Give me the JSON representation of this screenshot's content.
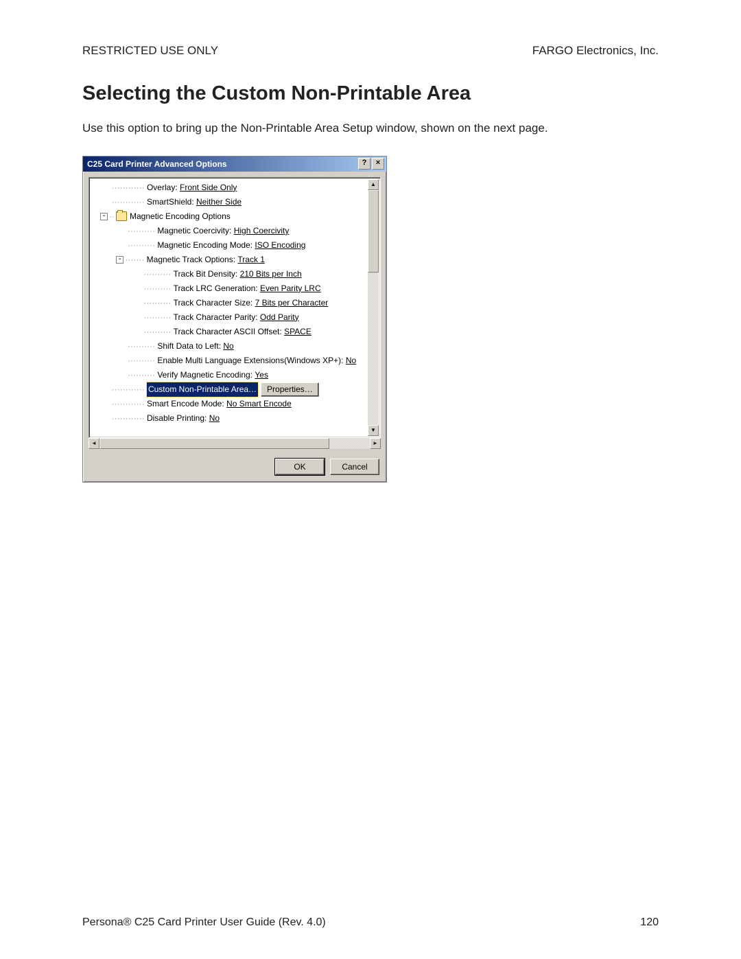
{
  "header": {
    "left": "RESTRICTED USE ONLY",
    "right": "FARGO Electronics, Inc."
  },
  "section": {
    "title": "Selecting the Custom Non-Printable Area",
    "text": "Use this option to bring up the Non-Printable Area Setup window, shown on the next page."
  },
  "dialog": {
    "title": "C25 Card Printer Advanced Options",
    "help_symbol": "?",
    "close_symbol": "×",
    "tree": {
      "r0": {
        "label": "Overlay:",
        "value": "Front Side Only"
      },
      "r1": {
        "label": "SmartShield:",
        "value": "Neither Side"
      },
      "r2": {
        "label": "Magnetic Encoding Options"
      },
      "r3": {
        "label": "Magnetic Coercivity:",
        "value": "High Coercivity"
      },
      "r4": {
        "label": "Magnetic Encoding Mode:",
        "value": "ISO Encoding"
      },
      "r5": {
        "label": "Magnetic Track Options:",
        "value": "Track 1"
      },
      "r6": {
        "label": "Track Bit Density:",
        "value": "210 Bits per Inch"
      },
      "r7": {
        "label": "Track LRC Generation:",
        "value": "Even Parity LRC"
      },
      "r8": {
        "label": "Track Character Size:",
        "value": "7 Bits per Character"
      },
      "r9": {
        "label": "Track Character Parity:",
        "value": "Odd Parity"
      },
      "r10": {
        "label": "Track Character ASCII Offset:",
        "value": "SPACE"
      },
      "r11": {
        "label": "Shift Data to Left:",
        "value": "No"
      },
      "r12": {
        "label": "Enable Multi Language Extensions(Windows XP+):",
        "value": "No"
      },
      "r13": {
        "label": "Verify Magnetic Encoding:",
        "value": "Yes"
      },
      "r14": {
        "label": "Custom Non-Printable Area…",
        "button": "Properties…"
      },
      "r15": {
        "label": "Smart Encode Mode:",
        "value": "No Smart Encode"
      },
      "r16": {
        "label": "Disable Printing:",
        "value": "No"
      }
    },
    "buttons": {
      "ok": "OK",
      "cancel": "Cancel"
    },
    "scroll": {
      "up": "▲",
      "down": "▼",
      "left": "◄",
      "right": "►"
    }
  },
  "footer": {
    "left": "Persona® C25 Card Printer User Guide (Rev. 4.0)",
    "page": "120"
  }
}
